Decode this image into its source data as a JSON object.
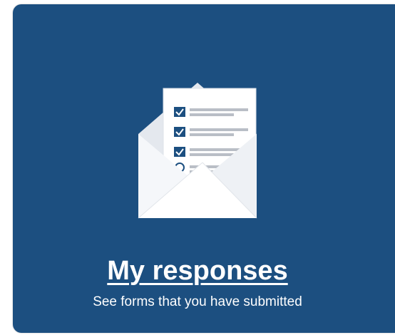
{
  "card": {
    "title": "My responses",
    "subtitle": "See forms that you have submitted",
    "icon": "envelope-with-checklist-icon",
    "background_color": "#1c4f80"
  }
}
